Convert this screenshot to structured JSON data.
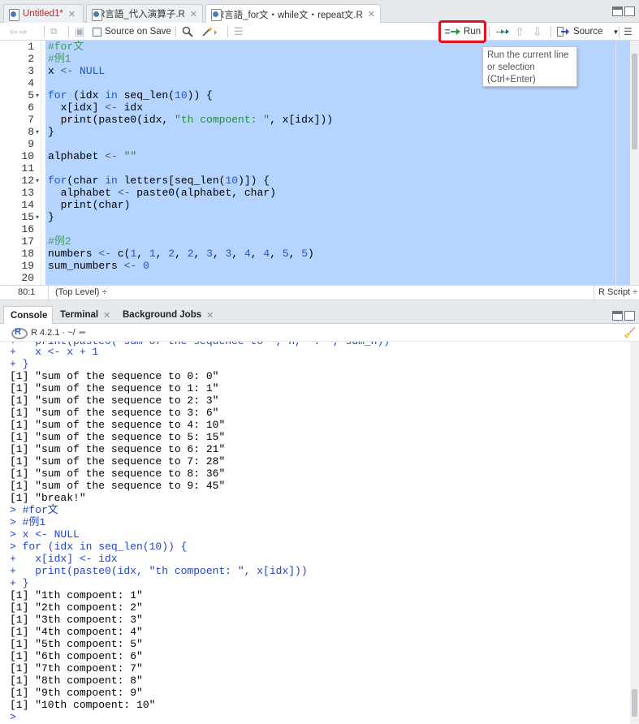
{
  "tabs": [
    {
      "label": "Untitled1*",
      "modified": true
    },
    {
      "label": "R言語_代入演算子.R"
    },
    {
      "label": "R言語_for文・while文・repeat文.R",
      "active": true
    }
  ],
  "toolbar": {
    "source_on_save": "Source on Save",
    "run": "Run",
    "source": "Source"
  },
  "tooltip": {
    "line1": "Run the current line",
    "line2": "or selection",
    "line3": "(Ctrl+Enter)"
  },
  "editor": {
    "line_numbers": [
      "1",
      "2",
      "3",
      "4",
      "5",
      "6",
      "7",
      "8",
      "9",
      "10",
      "11",
      "12",
      "13",
      "14",
      "15",
      "16",
      "17",
      "18",
      "19",
      "20"
    ],
    "lines": [
      "#for文",
      "#例1",
      "x <- NULL",
      "",
      "for (idx in seq_len(10)) {",
      "  x[idx] <- idx",
      "  print(paste0(idx, \"th compoent: \", x[idx]))",
      "}",
      "",
      "alphabet <- \"\"",
      "",
      "for(char in letters[seq_len(10)]) {",
      "  alphabet <- paste0(alphabet, char)",
      "  print(char)",
      "}",
      "",
      "#例2",
      "numbers <- c(1, 1, 2, 2, 3, 3, 4, 4, 5, 5)",
      "sum_numbers <- 0",
      ""
    ]
  },
  "status": {
    "position": "80:1",
    "scope": "(Top Level) ÷",
    "filetype": "R Script ÷"
  },
  "console_tabs": {
    "console": "Console",
    "terminal": "Terminal",
    "jobs": "Background Jobs"
  },
  "console_path": "R 4.2.1 · ~/",
  "console": {
    "lines": [
      "+   x <- x + 1",
      "+ }",
      "[1] \"sum of the sequence to 0: 0\"",
      "[1] \"sum of the sequence to 1: 1\"",
      "[1] \"sum of the sequence to 2: 3\"",
      "[1] \"sum of the sequence to 3: 6\"",
      "[1] \"sum of the sequence to 4: 10\"",
      "[1] \"sum of the sequence to 5: 15\"",
      "[1] \"sum of the sequence to 6: 21\"",
      "[1] \"sum of the sequence to 7: 28\"",
      "[1] \"sum of the sequence to 8: 36\"",
      "[1] \"sum of the sequence to 9: 45\"",
      "[1] \"break!\"",
      "> #for文",
      "> #例1",
      "> x <- NULL",
      "> for (idx in seq_len(10)) {",
      "+   x[idx] <- idx",
      "+   print(paste0(idx, \"th compoent: \", x[idx]))",
      "+ }",
      "[1] \"1th compoent: 1\"",
      "[1] \"2th compoent: 2\"",
      "[1] \"3th compoent: 3\"",
      "[1] \"4th compoent: 4\"",
      "[1] \"5th compoent: 5\"",
      "[1] \"6th compoent: 6\"",
      "[1] \"7th compoent: 7\"",
      "[1] \"8th compoent: 8\"",
      "[1] \"9th compoent: 9\"",
      "[1] \"10th compoent: 10\"",
      ">"
    ]
  },
  "colors": {
    "highlight": "#e0141e",
    "selection": "#b5d4ff"
  }
}
